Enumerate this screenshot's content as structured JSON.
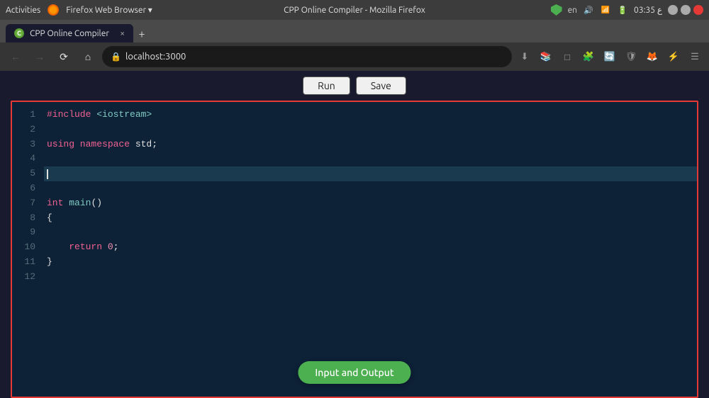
{
  "os": {
    "activities": "Activities",
    "time": "03:35 ع",
    "lang": "en",
    "browser_label": "Firefox Web Browser ▾"
  },
  "browser": {
    "title": "CPP Online Compiler - Mozilla Firefox",
    "tab_label": "CPP Online Compiler",
    "url": "localhost:3000",
    "close_tab": "×",
    "new_tab": "+"
  },
  "toolbar": {
    "run_label": "Run",
    "save_label": "Save"
  },
  "editor": {
    "lines": [
      {
        "num": "1",
        "content": "#include <iostream>",
        "type": "include"
      },
      {
        "num": "2",
        "content": "",
        "type": "empty"
      },
      {
        "num": "3",
        "content": "using namespace std;",
        "type": "using"
      },
      {
        "num": "4",
        "content": "",
        "type": "empty"
      },
      {
        "num": "5",
        "content": "",
        "type": "cursor",
        "active": true
      },
      {
        "num": "6",
        "content": "",
        "type": "empty"
      },
      {
        "num": "7",
        "content": "int main()",
        "type": "main"
      },
      {
        "num": "8",
        "content": "{",
        "type": "brace"
      },
      {
        "num": "9",
        "content": "",
        "type": "empty"
      },
      {
        "num": "10",
        "content": "    return 0;",
        "type": "return"
      },
      {
        "num": "11",
        "content": "}",
        "type": "brace"
      },
      {
        "num": "12",
        "content": "",
        "type": "empty"
      }
    ]
  },
  "io_button": {
    "label": "Input and Output"
  },
  "nav": {
    "url_display": "localhost:3000"
  }
}
